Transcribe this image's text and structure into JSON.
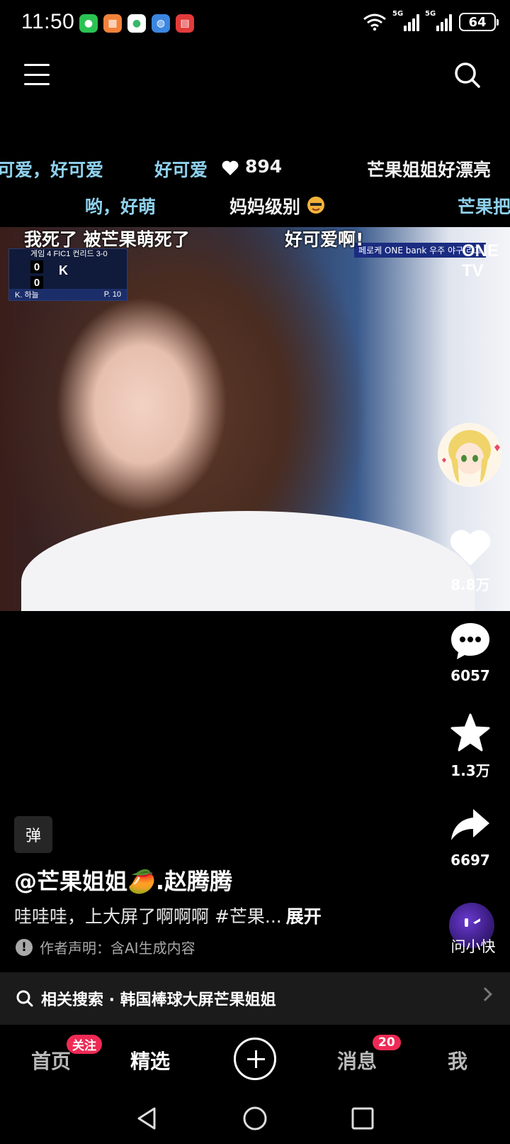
{
  "status_bar": {
    "time": "11:50",
    "battery": "64",
    "network_1": "5G",
    "network_2": "5G"
  },
  "danmaku": [
    {
      "text": "可爱，好可爱",
      "style": "blue"
    },
    {
      "text": "好可爱",
      "style": "blue"
    },
    {
      "text": "894",
      "style": "white"
    },
    {
      "text": "芒果姐姐好漂亮",
      "style": "white"
    },
    {
      "text": "哟，好萌",
      "style": "blue"
    },
    {
      "text": "妈妈级别",
      "style": "white"
    },
    {
      "text": "芒果把",
      "style": "blue"
    }
  ],
  "video": {
    "overlay_left": "我死了   被芒果萌死了",
    "overlay_right": "好可爱啊!",
    "scoreboard_header": "게임 4    FIC1 컨리드 3-0",
    "score_home": "0",
    "score_away": "0",
    "strike_indicator": "K",
    "scoreboard_player": "K. 하늘",
    "scoreboard_pitch": "P. 10",
    "broadcast_banner": "페로케 ONE bank 우주 야구 리그",
    "channel_logo": "ONE TV"
  },
  "rail": {
    "likes": "8.8万",
    "comments": "6057",
    "favorites": "1.3万",
    "shares": "6697"
  },
  "post": {
    "tag": "弹",
    "author": "@芒果姐姐🥭.赵腾腾",
    "description": "哇哇哇，上大屏了啊啊啊 #芒果...",
    "expand": "展开",
    "ai_notice": "作者声明：含AI生成内容",
    "assistant_label": "问小快"
  },
  "related_search": "相关搜索 · 韩国棒球大屏芒果姐姐",
  "tabs": {
    "home": "首页",
    "home_badge": "关注",
    "featured": "精选",
    "messages": "消息",
    "messages_badge": "20",
    "me": "我"
  },
  "colors": {
    "danmaku_blue": "#8fd2ee",
    "badge_red": "#ee2a55"
  }
}
